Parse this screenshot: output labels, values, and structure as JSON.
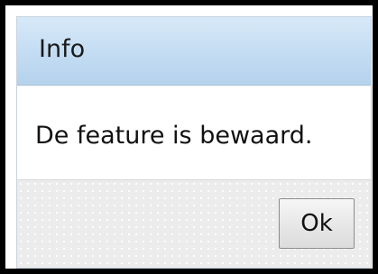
{
  "dialog": {
    "title": "Info",
    "message": "De feature is bewaard.",
    "ok_label": "Ok"
  }
}
